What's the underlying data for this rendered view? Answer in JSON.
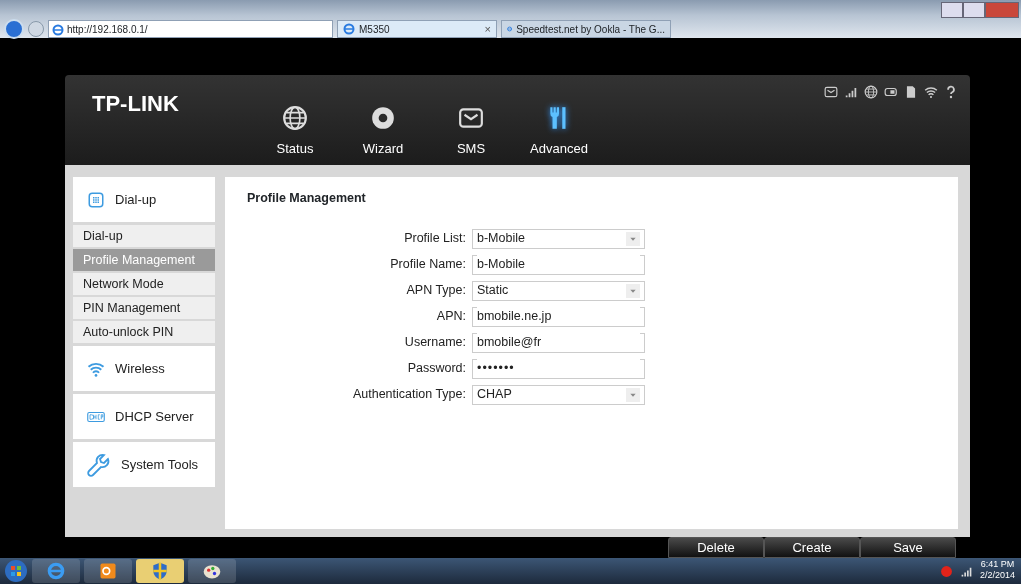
{
  "browser": {
    "address": "http://192.168.0.1/",
    "tabs": [
      {
        "title": "M5350",
        "selected": true,
        "close": "×"
      },
      {
        "title": "Speedtest.net by Ookla - The G...",
        "selected": false
      }
    ]
  },
  "router": {
    "logo": "TP-LINK",
    "nav": [
      {
        "label": "Status",
        "kind": "globe",
        "selected": false
      },
      {
        "label": "Wizard",
        "kind": "gear",
        "selected": false
      },
      {
        "label": "SMS",
        "kind": "mail",
        "selected": false
      },
      {
        "label": "Advanced",
        "kind": "tools",
        "selected": true
      }
    ],
    "sidebar": [
      {
        "label": "Dial-up",
        "kind": "keypad",
        "children": [
          {
            "label": "Dial-up",
            "selected": false
          },
          {
            "label": "Profile Management",
            "selected": true
          },
          {
            "label": "Network Mode",
            "selected": false
          },
          {
            "label": "PIN Management",
            "selected": false
          },
          {
            "label": "Auto-unlock PIN",
            "selected": false
          }
        ]
      },
      {
        "label": "Wireless",
        "kind": "wifi"
      },
      {
        "label": "DHCP Server",
        "kind": "dhcp"
      },
      {
        "label": "System Tools",
        "kind": "wrench"
      }
    ],
    "form": {
      "title": "Profile Management",
      "fields": [
        {
          "label": "Profile List:",
          "kind": "select",
          "value": "b-Mobile"
        },
        {
          "label": "Profile Name:",
          "kind": "text",
          "value": "b-Mobile"
        },
        {
          "label": "APN Type:",
          "kind": "select",
          "value": "Static"
        },
        {
          "label": "APN:",
          "kind": "text",
          "value": "bmobile.ne.jp"
        },
        {
          "label": "Username:",
          "kind": "text",
          "value": "bmobile@fr"
        },
        {
          "label": "Password:",
          "kind": "password",
          "value": "•••••••"
        },
        {
          "label": "Authentication Type:",
          "kind": "select",
          "value": "CHAP"
        }
      ]
    },
    "buttons": [
      "Delete",
      "Create",
      "Save"
    ]
  },
  "taskbar": {
    "time": "6:41 PM",
    "date": "2/2/2014"
  }
}
